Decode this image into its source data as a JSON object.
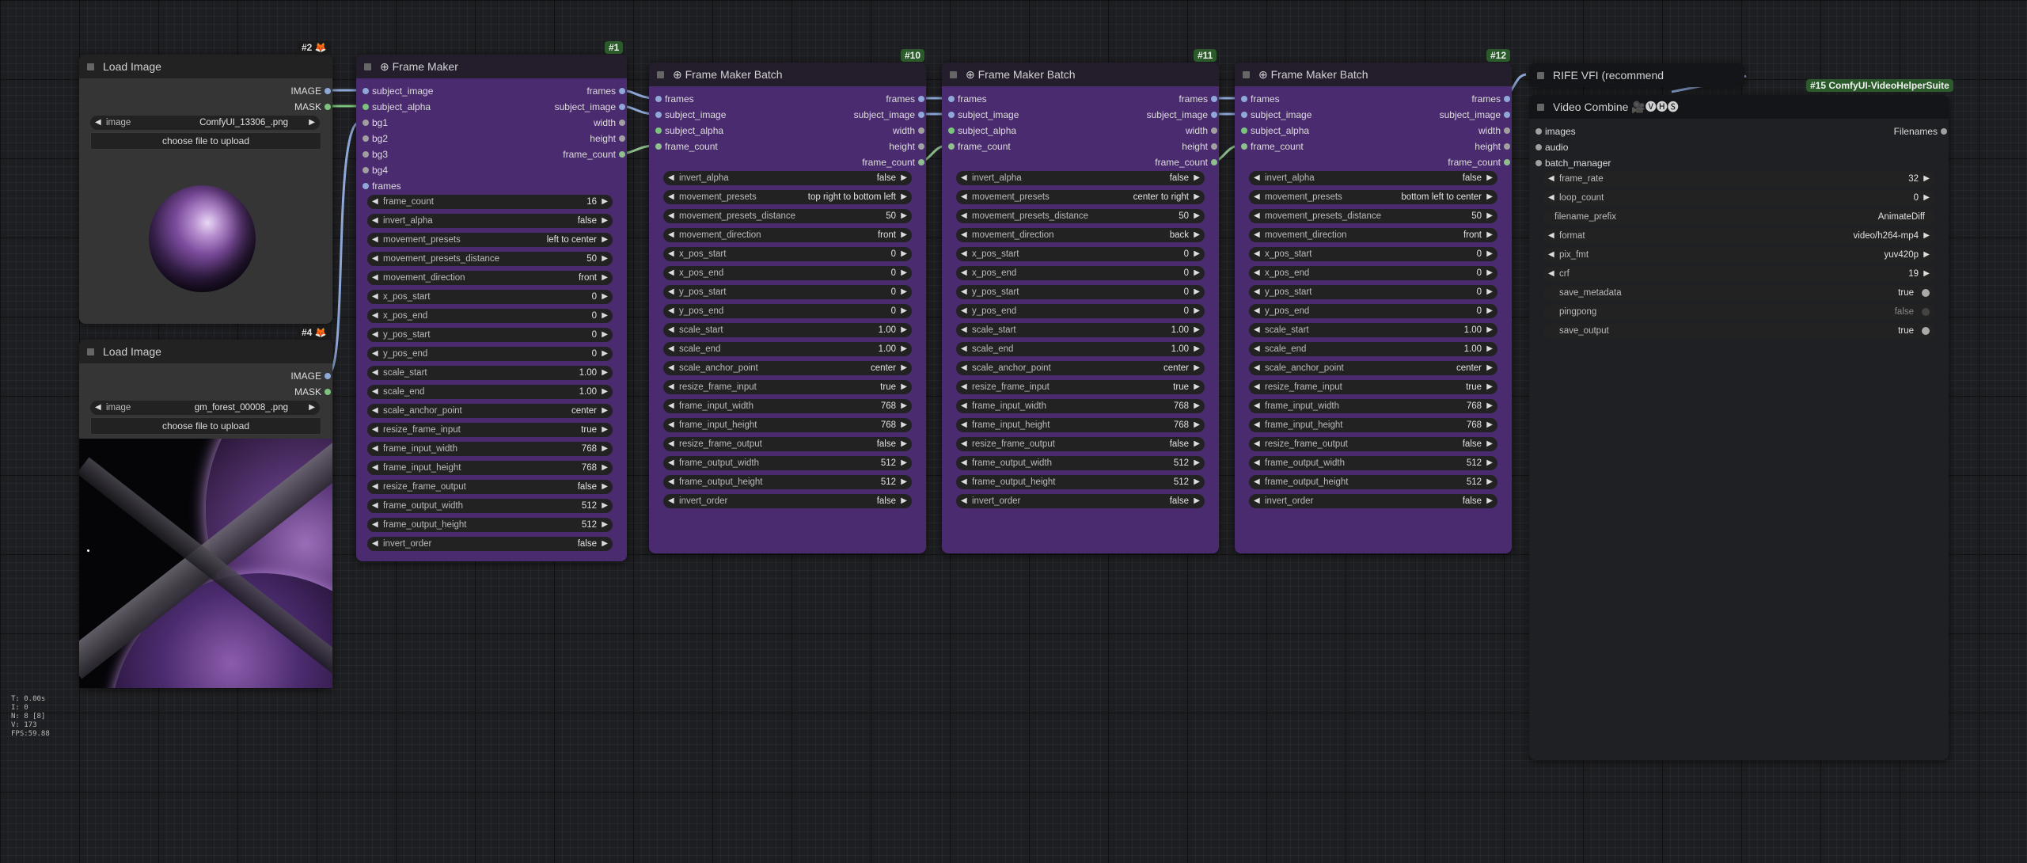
{
  "colors": {
    "canvas": "#1d1e21",
    "purple_node": "#4b2b6f",
    "grey_node": "#353535",
    "image_link": "#8fa8d8",
    "mask_link": "#7bc47b",
    "int_link": "#8fbf8f",
    "badge_green": "#2b5b2b"
  },
  "stats": {
    "t": "T: 0.00s",
    "i": "I: 0",
    "n": "N: 8 [8]",
    "v": "V: 173",
    "fps": "FPS:59.88"
  },
  "load_image_1": {
    "id": "#2",
    "title": "Load Image",
    "outputs": [
      "IMAGE",
      "MASK"
    ],
    "image_label": "image",
    "image_value": "ComfyUI_13306_.png",
    "upload": "choose file to upload"
  },
  "load_image_2": {
    "id": "#4",
    "title": "Load Image",
    "outputs": [
      "IMAGE",
      "MASK"
    ],
    "image_label": "image",
    "image_value": "gm_forest_00008_.png",
    "upload": "choose file to upload"
  },
  "frame_maker": {
    "id": "#1",
    "title": "Frame Maker",
    "inputs": [
      "subject_image",
      "subject_alpha",
      "bg1",
      "bg2",
      "bg3",
      "bg4",
      "frames"
    ],
    "outputs": [
      "frames",
      "subject_image",
      "width",
      "height",
      "frame_count"
    ],
    "widgets": [
      {
        "label": "frame_count",
        "value": "16"
      },
      {
        "label": "invert_alpha",
        "value": "false"
      },
      {
        "label": "movement_presets",
        "value": "left to center"
      },
      {
        "label": "movement_presets_distance",
        "value": "50"
      },
      {
        "label": "movement_direction",
        "value": "front"
      },
      {
        "label": "x_pos_start",
        "value": "0"
      },
      {
        "label": "x_pos_end",
        "value": "0"
      },
      {
        "label": "y_pos_start",
        "value": "0"
      },
      {
        "label": "y_pos_end",
        "value": "0"
      },
      {
        "label": "scale_start",
        "value": "1.00"
      },
      {
        "label": "scale_end",
        "value": "1.00"
      },
      {
        "label": "scale_anchor_point",
        "value": "center"
      },
      {
        "label": "resize_frame_input",
        "value": "true"
      },
      {
        "label": "frame_input_width",
        "value": "768"
      },
      {
        "label": "frame_input_height",
        "value": "768"
      },
      {
        "label": "resize_frame_output",
        "value": "false"
      },
      {
        "label": "frame_output_width",
        "value": "512"
      },
      {
        "label": "frame_output_height",
        "value": "512"
      },
      {
        "label": "invert_order",
        "value": "false"
      }
    ]
  },
  "batches": [
    {
      "id": "#10",
      "title": "Frame Maker Batch",
      "inputs": [
        "frames",
        "subject_image",
        "subject_alpha",
        "frame_count"
      ],
      "outputs": [
        "frames",
        "subject_image",
        "width",
        "height",
        "frame_count"
      ],
      "widgets": [
        {
          "label": "invert_alpha",
          "value": "false"
        },
        {
          "label": "movement_presets",
          "value": "top right to bottom left"
        },
        {
          "label": "movement_presets_distance",
          "value": "50"
        },
        {
          "label": "movement_direction",
          "value": "front"
        },
        {
          "label": "x_pos_start",
          "value": "0"
        },
        {
          "label": "x_pos_end",
          "value": "0"
        },
        {
          "label": "y_pos_start",
          "value": "0"
        },
        {
          "label": "y_pos_end",
          "value": "0"
        },
        {
          "label": "scale_start",
          "value": "1.00"
        },
        {
          "label": "scale_end",
          "value": "1.00"
        },
        {
          "label": "scale_anchor_point",
          "value": "center"
        },
        {
          "label": "resize_frame_input",
          "value": "true"
        },
        {
          "label": "frame_input_width",
          "value": "768"
        },
        {
          "label": "frame_input_height",
          "value": "768"
        },
        {
          "label": "resize_frame_output",
          "value": "false"
        },
        {
          "label": "frame_output_width",
          "value": "512"
        },
        {
          "label": "frame_output_height",
          "value": "512"
        },
        {
          "label": "invert_order",
          "value": "false"
        }
      ]
    },
    {
      "id": "#11",
      "title": "Frame Maker Batch",
      "inputs": [
        "frames",
        "subject_image",
        "subject_alpha",
        "frame_count"
      ],
      "outputs": [
        "frames",
        "subject_image",
        "width",
        "height",
        "frame_count"
      ],
      "widgets": [
        {
          "label": "invert_alpha",
          "value": "false"
        },
        {
          "label": "movement_presets",
          "value": "center to right"
        },
        {
          "label": "movement_presets_distance",
          "value": "50"
        },
        {
          "label": "movement_direction",
          "value": "back"
        },
        {
          "label": "x_pos_start",
          "value": "0"
        },
        {
          "label": "x_pos_end",
          "value": "0"
        },
        {
          "label": "y_pos_start",
          "value": "0"
        },
        {
          "label": "y_pos_end",
          "value": "0"
        },
        {
          "label": "scale_start",
          "value": "1.00"
        },
        {
          "label": "scale_end",
          "value": "1.00"
        },
        {
          "label": "scale_anchor_point",
          "value": "center"
        },
        {
          "label": "resize_frame_input",
          "value": "true"
        },
        {
          "label": "frame_input_width",
          "value": "768"
        },
        {
          "label": "frame_input_height",
          "value": "768"
        },
        {
          "label": "resize_frame_output",
          "value": "false"
        },
        {
          "label": "frame_output_width",
          "value": "512"
        },
        {
          "label": "frame_output_height",
          "value": "512"
        },
        {
          "label": "invert_order",
          "value": "false"
        }
      ]
    },
    {
      "id": "#12",
      "title": "Frame Maker Batch",
      "inputs": [
        "frames",
        "subject_image",
        "subject_alpha",
        "frame_count"
      ],
      "outputs": [
        "frames",
        "subject_image",
        "width",
        "height",
        "frame_count"
      ],
      "widgets": [
        {
          "label": "invert_alpha",
          "value": "false"
        },
        {
          "label": "movement_presets",
          "value": "bottom left to center"
        },
        {
          "label": "movement_presets_distance",
          "value": "50"
        },
        {
          "label": "movement_direction",
          "value": "front"
        },
        {
          "label": "x_pos_start",
          "value": "0"
        },
        {
          "label": "x_pos_end",
          "value": "0"
        },
        {
          "label": "y_pos_start",
          "value": "0"
        },
        {
          "label": "y_pos_end",
          "value": "0"
        },
        {
          "label": "scale_start",
          "value": "1.00"
        },
        {
          "label": "scale_end",
          "value": "1.00"
        },
        {
          "label": "scale_anchor_point",
          "value": "center"
        },
        {
          "label": "resize_frame_input",
          "value": "true"
        },
        {
          "label": "frame_input_width",
          "value": "768"
        },
        {
          "label": "frame_input_height",
          "value": "768"
        },
        {
          "label": "resize_frame_output",
          "value": "false"
        },
        {
          "label": "frame_output_width",
          "value": "512"
        },
        {
          "label": "frame_output_height",
          "value": "512"
        },
        {
          "label": "invert_order",
          "value": "false"
        }
      ]
    }
  ],
  "rife": {
    "title": "RIFE VFI (recommend"
  },
  "video_combine": {
    "badge": "#15 ComfyUI-VideoHelperSuite",
    "title": "Video Combine 🎥🅥🅗🅢",
    "inputs": [
      "images",
      "audio",
      "batch_manager"
    ],
    "output": "Filenames",
    "widgets": [
      {
        "label": "frame_rate",
        "value": "32",
        "kind": "number"
      },
      {
        "label": "loop_count",
        "value": "0",
        "kind": "number"
      },
      {
        "label": "filename_prefix",
        "value": "AnimateDiff",
        "kind": "text"
      },
      {
        "label": "format",
        "value": "video/h264-mp4",
        "kind": "number"
      },
      {
        "label": "pix_fmt",
        "value": "yuv420p",
        "kind": "number"
      },
      {
        "label": "crf",
        "value": "19",
        "kind": "number"
      },
      {
        "label": "save_metadata",
        "value": "true",
        "kind": "toggle-on"
      },
      {
        "label": "pingpong",
        "value": "false",
        "kind": "toggle-off"
      },
      {
        "label": "save_output",
        "value": "true",
        "kind": "toggle-on"
      }
    ]
  }
}
